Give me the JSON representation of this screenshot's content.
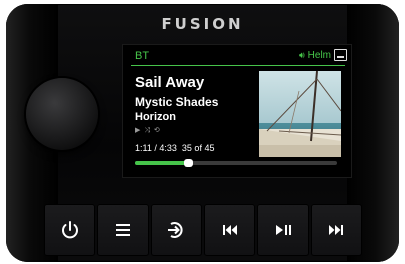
{
  "device": {
    "brand": "FUSION"
  },
  "screen": {
    "source": "BT",
    "zone": "Helm",
    "track": {
      "title": "Sail Away",
      "artist": "Mystic Shades",
      "album": "Horizon",
      "elapsed": "1:11",
      "duration": "4:33",
      "position": "35 of 45",
      "progress": 0.26
    },
    "modes_icons": [
      "play-icon",
      "shuffle-icon",
      "repeat-icon"
    ],
    "accent_color": "#46c44a"
  },
  "buttons": [
    {
      "icon": "power-icon"
    },
    {
      "icon": "menu-icon"
    },
    {
      "icon": "source-icon"
    },
    {
      "icon": "previous-track-icon"
    },
    {
      "icon": "play-pause-icon"
    },
    {
      "icon": "next-track-icon"
    }
  ]
}
